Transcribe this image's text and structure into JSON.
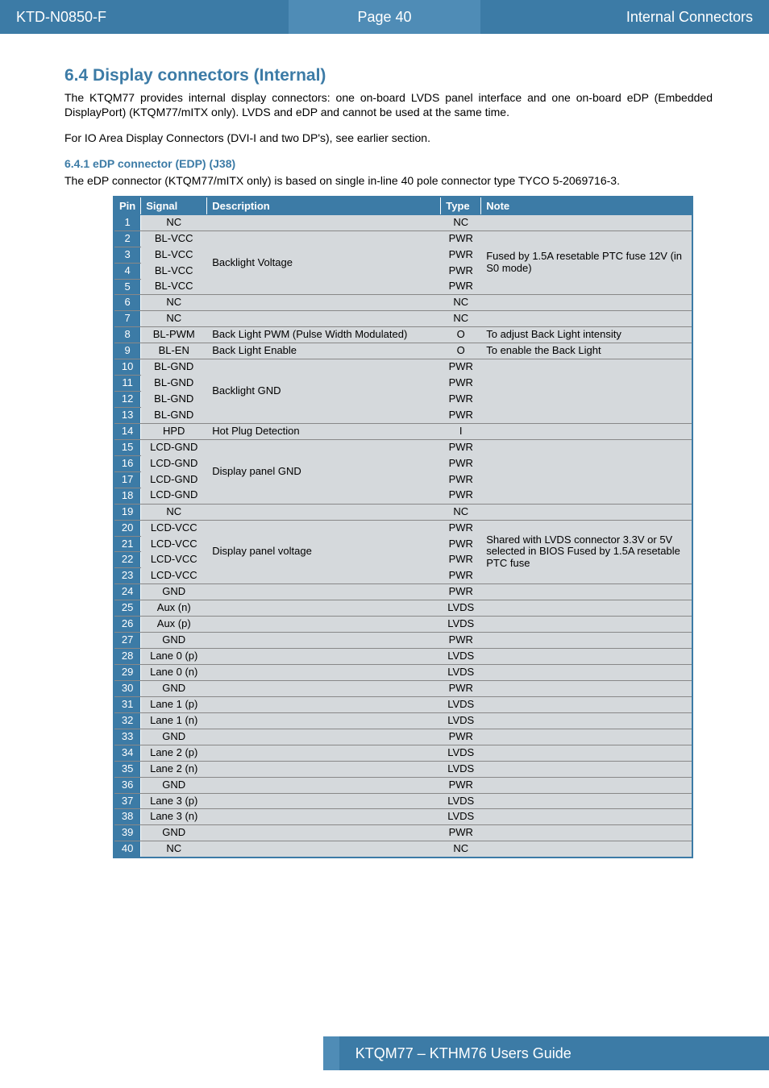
{
  "header": {
    "left": "KTD-N0850-F",
    "center": "Page 40",
    "right": "Internal Connectors"
  },
  "section": {
    "title": "6.4  Display connectors (Internal)",
    "intro1": "The KTQM77 provides internal display connectors: one on-board LVDS panel interface and one on-board eDP (Embedded DisplayPort) (KTQM77/mITX only). LVDS and eDP and cannot be used at the same time.",
    "intro2": "For IO Area Display Connectors (DVI-I and two DP's), see earlier section."
  },
  "subsection": {
    "title": "6.4.1   eDP connector (EDP) (J38)",
    "text": "The eDP connector (KTQM77/mITX only) is based on single in-line 40 pole connector type TYCO 5-2069716-3."
  },
  "table": {
    "headers": {
      "pin": "Pin",
      "signal": "Signal",
      "desc": "Description",
      "type": "Type",
      "note": "Note"
    },
    "rows": [
      {
        "pin": "1",
        "signal": "NC",
        "desc": "",
        "type": "NC",
        "note": "",
        "groupNext": false
      },
      {
        "pin": "2",
        "signal": "BL-VCC",
        "desc": "Backlight Voltage",
        "type": "PWR",
        "note": "Fused by 1.5A resetable PTC fuse 12V (in S0 mode)",
        "groupStart": true,
        "groupSpan": 4
      },
      {
        "pin": "3",
        "signal": "BL-VCC",
        "type": "PWR",
        "groupMid": true
      },
      {
        "pin": "4",
        "signal": "BL-VCC",
        "type": "PWR",
        "groupMid": true
      },
      {
        "pin": "5",
        "signal": "BL-VCC",
        "type": "PWR",
        "groupEnd": true
      },
      {
        "pin": "6",
        "signal": "NC",
        "desc": "",
        "type": "NC",
        "note": ""
      },
      {
        "pin": "7",
        "signal": "NC",
        "desc": "",
        "type": "NC",
        "note": ""
      },
      {
        "pin": "8",
        "signal": "BL-PWM",
        "desc": "Back Light PWM (Pulse Width Modulated)",
        "type": "O",
        "note": "To adjust Back Light intensity"
      },
      {
        "pin": "9",
        "signal": "BL-EN",
        "desc": "Back Light Enable",
        "type": "O",
        "note": "To enable the Back Light"
      },
      {
        "pin": "10",
        "signal": "BL-GND",
        "desc": "Backlight GND",
        "type": "PWR",
        "note": "",
        "groupStart": true,
        "groupSpan": 4
      },
      {
        "pin": "11",
        "signal": "BL-GND",
        "type": "PWR",
        "groupMid": true
      },
      {
        "pin": "12",
        "signal": "BL-GND",
        "type": "PWR",
        "groupMid": true
      },
      {
        "pin": "13",
        "signal": "BL-GND",
        "type": "PWR",
        "groupEnd": true
      },
      {
        "pin": "14",
        "signal": "HPD",
        "desc": "Hot Plug Detection",
        "type": "I",
        "note": ""
      },
      {
        "pin": "15",
        "signal": "LCD-GND",
        "desc": "Display panel GND",
        "type": "PWR",
        "note": "",
        "groupStart": true,
        "groupSpan": 4
      },
      {
        "pin": "16",
        "signal": "LCD-GND",
        "type": "PWR",
        "groupMid": true
      },
      {
        "pin": "17",
        "signal": "LCD-GND",
        "type": "PWR",
        "groupMid": true
      },
      {
        "pin": "18",
        "signal": "LCD-GND",
        "type": "PWR",
        "groupEnd": true
      },
      {
        "pin": "19",
        "signal": "NC",
        "desc": "",
        "type": "NC",
        "note": ""
      },
      {
        "pin": "20",
        "signal": "LCD-VCC",
        "desc": "Display panel voltage",
        "type": "PWR",
        "note": "Shared with LVDS connector 3.3V or 5V selected in BIOS Fused by 1.5A resetable PTC fuse",
        "groupStart": true,
        "groupSpan": 4
      },
      {
        "pin": "21",
        "signal": "LCD-VCC",
        "type": "PWR",
        "groupMid": true
      },
      {
        "pin": "22",
        "signal": "LCD-VCC",
        "type": "PWR",
        "groupMid": true
      },
      {
        "pin": "23",
        "signal": "LCD-VCC",
        "type": "PWR",
        "groupEnd": true
      },
      {
        "pin": "24",
        "signal": "GND",
        "desc": "",
        "type": "PWR",
        "note": ""
      },
      {
        "pin": "25",
        "signal": "Aux (n)",
        "desc": "",
        "type": "LVDS",
        "note": ""
      },
      {
        "pin": "26",
        "signal": "Aux (p)",
        "desc": "",
        "type": "LVDS",
        "note": ""
      },
      {
        "pin": "27",
        "signal": "GND",
        "desc": "",
        "type": "PWR",
        "note": ""
      },
      {
        "pin": "28",
        "signal": "Lane 0 (p)",
        "desc": "",
        "type": "LVDS",
        "note": ""
      },
      {
        "pin": "29",
        "signal": "Lane 0 (n)",
        "desc": "",
        "type": "LVDS",
        "note": ""
      },
      {
        "pin": "30",
        "signal": "GND",
        "desc": "",
        "type": "PWR",
        "note": ""
      },
      {
        "pin": "31",
        "signal": "Lane 1 (p)",
        "desc": "",
        "type": "LVDS",
        "note": ""
      },
      {
        "pin": "32",
        "signal": "Lane 1 (n)",
        "desc": "",
        "type": "LVDS",
        "note": ""
      },
      {
        "pin": "33",
        "signal": "GND",
        "desc": "",
        "type": "PWR",
        "note": ""
      },
      {
        "pin": "34",
        "signal": "Lane 2 (p)",
        "desc": "",
        "type": "LVDS",
        "note": ""
      },
      {
        "pin": "35",
        "signal": "Lane 2 (n)",
        "desc": "",
        "type": "LVDS",
        "note": ""
      },
      {
        "pin": "36",
        "signal": "GND",
        "desc": "",
        "type": "PWR",
        "note": ""
      },
      {
        "pin": "37",
        "signal": "Lane 3 (p)",
        "desc": "",
        "type": "LVDS",
        "note": ""
      },
      {
        "pin": "38",
        "signal": "Lane 3 (n)",
        "desc": "",
        "type": "LVDS",
        "note": ""
      },
      {
        "pin": "39",
        "signal": "GND",
        "desc": "",
        "type": "PWR",
        "note": ""
      },
      {
        "pin": "40",
        "signal": "NC",
        "desc": "",
        "type": "NC",
        "note": ""
      }
    ]
  },
  "footer": "KTQM77 – KTHM76 Users Guide"
}
